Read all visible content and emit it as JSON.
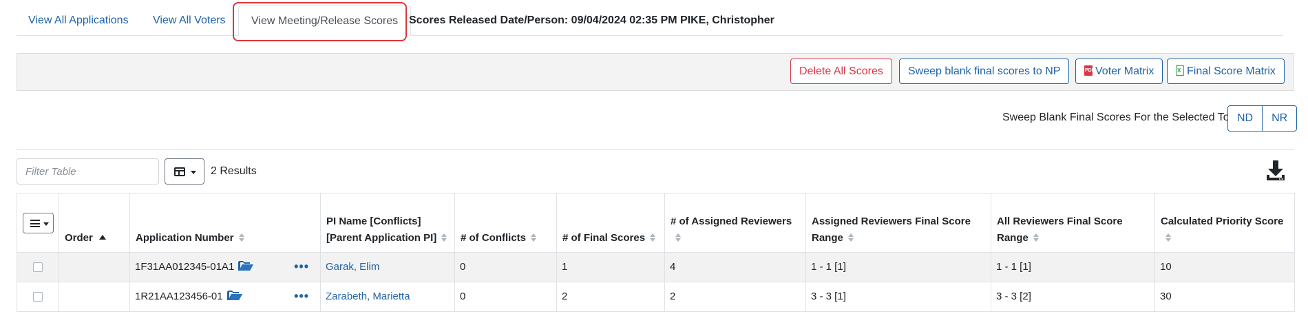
{
  "tabs": {
    "view_all_applications": "View All Applications",
    "view_all_voters": "View All Voters",
    "view_meeting_release_scores": "View Meeting/Release Scores"
  },
  "scores_released": "Scores Released Date/Person: 09/04/2024 02:35 PM PIKE, Christopher",
  "toolbar": {
    "delete_all_scores": "Delete All Scores",
    "sweep_blank_to_np": "Sweep blank final scores to NP",
    "voter_matrix": "Voter Matrix",
    "final_score_matrix": "Final Score Matrix"
  },
  "sweep": {
    "label": "Sweep Blank Final Scores For the Selected To:",
    "nd": "ND",
    "nr": "NR"
  },
  "filter": {
    "placeholder": "Filter Table",
    "results": "2 Results"
  },
  "table": {
    "headers": {
      "order": "Order",
      "application_number": "Application Number",
      "pi_name": "PI Name [Conflicts] [Parent Application PI]",
      "num_conflicts": "# of Conflicts",
      "num_final_scores": "# of Final Scores",
      "num_assigned_reviewers": "# of Assigned Reviewers",
      "assigned_range": "Assigned Reviewers Final Score Range",
      "all_range": "All Reviewers Final Score Range",
      "priority_score": "Calculated Priority Score"
    },
    "rows": [
      {
        "order": "",
        "application_number": "1F31AA012345-01A1",
        "pi_name": "Garak, Elim",
        "num_conflicts": "0",
        "num_final_scores": "1",
        "num_assigned_reviewers": "4",
        "assigned_range": "1 - 1 [1]",
        "all_range": "1 - 1 [1]",
        "priority_score": "10"
      },
      {
        "order": "",
        "application_number": "1R21AA123456-01",
        "pi_name": "Zarabeth, Marietta",
        "num_conflicts": "0",
        "num_final_scores": "2",
        "num_assigned_reviewers": "2",
        "assigned_range": "3 - 3 [1]",
        "all_range": "3 - 3 [2]",
        "priority_score": "30"
      }
    ]
  },
  "icons": {
    "voter_matrix": "pdf-file-icon",
    "final_score_matrix": "excel-file-icon",
    "application_folder": "folder-open-icon",
    "row_actions": "ellipsis-icon",
    "download": "download-icon",
    "column_toggle": "columns-icon",
    "row_menu": "hamburger-menu-icon"
  },
  "colors": {
    "link": "#1f63a8",
    "danger": "#dc3545",
    "excel": "#28a745",
    "highlight": "#e0353a"
  }
}
